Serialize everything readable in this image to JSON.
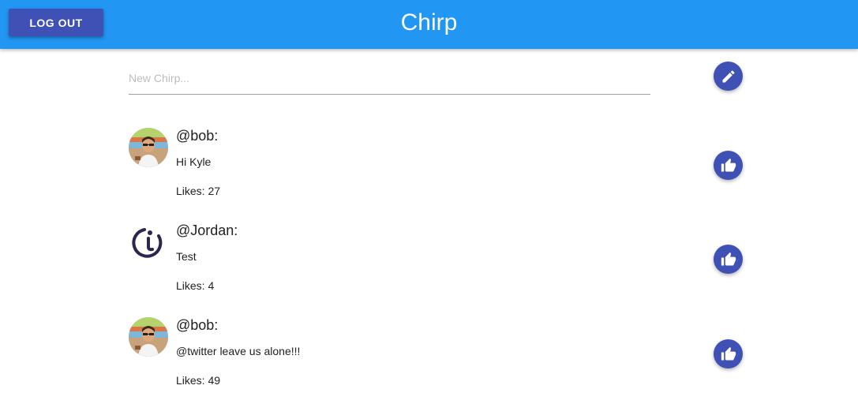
{
  "header": {
    "title": "Chirp",
    "logout_label": "LOG OUT",
    "bar_color": "#2196F3",
    "accent_color": "#3F51B5"
  },
  "compose": {
    "placeholder": "New Chirp...",
    "value": "",
    "submit_icon": "pencil-icon"
  },
  "chirps": [
    {
      "handle": "@bob:",
      "text": "Hi Kyle",
      "likes": "Likes: 27",
      "avatar": "cartoon-avatar",
      "like_icon": "thumbs-up-icon"
    },
    {
      "handle": "@Jordan:",
      "text": "Test",
      "likes": "Likes: 4",
      "avatar": "logo-avatar",
      "like_icon": "thumbs-up-icon"
    },
    {
      "handle": "@bob:",
      "text": "@twitter leave us alone!!!",
      "likes": "Likes: 49",
      "avatar": "cartoon-avatar",
      "like_icon": "thumbs-up-icon"
    }
  ]
}
